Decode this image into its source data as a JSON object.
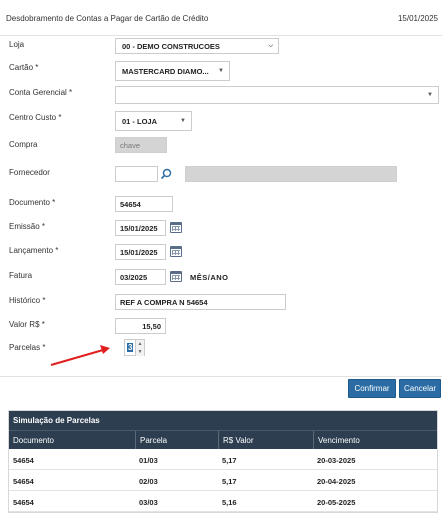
{
  "header": {
    "title": "Desdobramento de Contas a Pagar de Cartão de Crédito",
    "date": "15/01/2025"
  },
  "form": {
    "loja": {
      "label": "Loja",
      "value": "00 - DEMO CONSTRUCOES"
    },
    "cartao": {
      "label": "Cartão *",
      "value": "MASTERCARD DIAMO..."
    },
    "conta_gerencial": {
      "label": "Conta Gerencial *",
      "value": ""
    },
    "centro_custo": {
      "label": "Centro Custo *",
      "value": "01 - LOJA"
    },
    "compra": {
      "label": "Compra",
      "placeholder": "chave"
    },
    "fornecedor": {
      "label": "Fornecedor",
      "value": ""
    },
    "documento": {
      "label": "Documento *",
      "value": "54654"
    },
    "emissao": {
      "label": "Emissão *",
      "value": "15/01/2025"
    },
    "lancamento": {
      "label": "Lançamento *",
      "value": "15/01/2025"
    },
    "fatura": {
      "label": "Fatura",
      "value": "03/2025",
      "hint": "MÊS/ANO"
    },
    "historico": {
      "label": "Histórico *",
      "value": "REF A COMPRA N 54654"
    },
    "valor": {
      "label": "Valor R$ *",
      "value": "15,50"
    },
    "parcelas": {
      "label": "Parcelas *",
      "value": "3"
    }
  },
  "buttons": {
    "confirmar": "Confirmar",
    "cancelar": "Cancelar"
  },
  "simulation": {
    "title": "Simulação de Parcelas",
    "columns": [
      "Documento",
      "Parcela",
      "R$ Valor",
      "Vencimento"
    ],
    "rows": [
      [
        "54654",
        "01/03",
        "5,17",
        "20-03-2025"
      ],
      [
        "54654",
        "02/03",
        "5,17",
        "20-04-2025"
      ],
      [
        "54654",
        "03/03",
        "5,16",
        "20-05-2025"
      ]
    ]
  },
  "colors": {
    "primary_button": "#2a6ca3",
    "grid_header": "#2c3e50",
    "annotation_arrow": "#e02020"
  },
  "icons": [
    "chevron-down-icon",
    "search-icon",
    "calendar-icon",
    "spinner-up-icon",
    "spinner-down-icon"
  ]
}
